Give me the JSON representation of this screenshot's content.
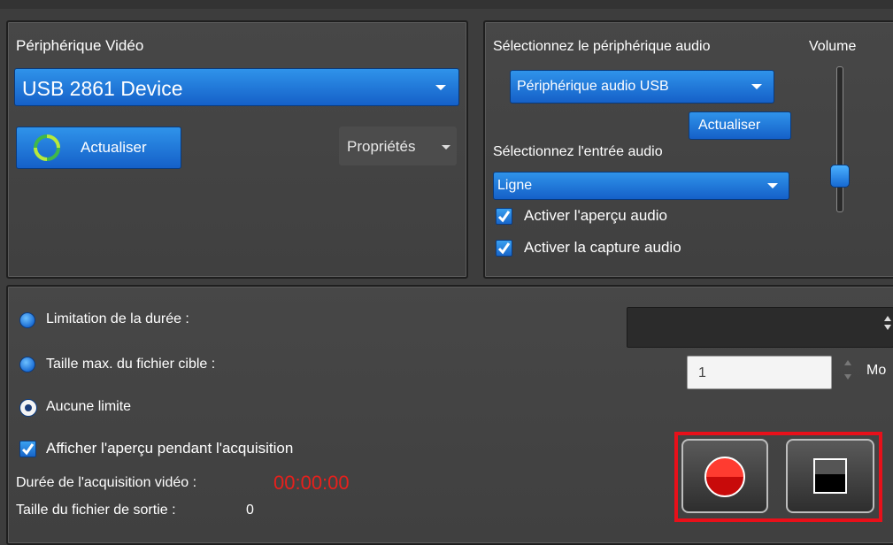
{
  "video_panel": {
    "title": "Périphérique Vidéo",
    "device_value": "USB 2861 Device",
    "refresh_label": "Actualiser",
    "properties_label": "Propriétés"
  },
  "audio_panel": {
    "select_device_label": "Sélectionnez le périphérique audio",
    "volume_label": "Volume",
    "device_value": "Périphérique audio USB",
    "refresh_label": "Actualiser",
    "select_input_label": "Sélectionnez l'entrée audio",
    "input_value": "Ligne",
    "enable_preview_label": "Activer l'aperçu audio",
    "enable_capture_label": "Activer la capture audio",
    "volume_level": 0.2
  },
  "capture_panel": {
    "duration_limit_label": "Limitation de la durée :",
    "max_size_label": "Taille max. du fichier cible :",
    "max_size_value": "1",
    "max_size_unit": "Mo",
    "no_limit_label": "Aucune limite",
    "show_preview_label": "Afficher l'aperçu pendant l'acquisition",
    "acq_duration_label": "Durée de l'acquisition vidéo :",
    "acq_duration_value": "00:00:00",
    "output_size_label": "Taille du fichier de sortie :",
    "output_size_value": "0"
  },
  "colors": {
    "accent_blue": "#1f78d8",
    "timer_red": "#e8201c",
    "highlight_red": "#e8101a"
  }
}
